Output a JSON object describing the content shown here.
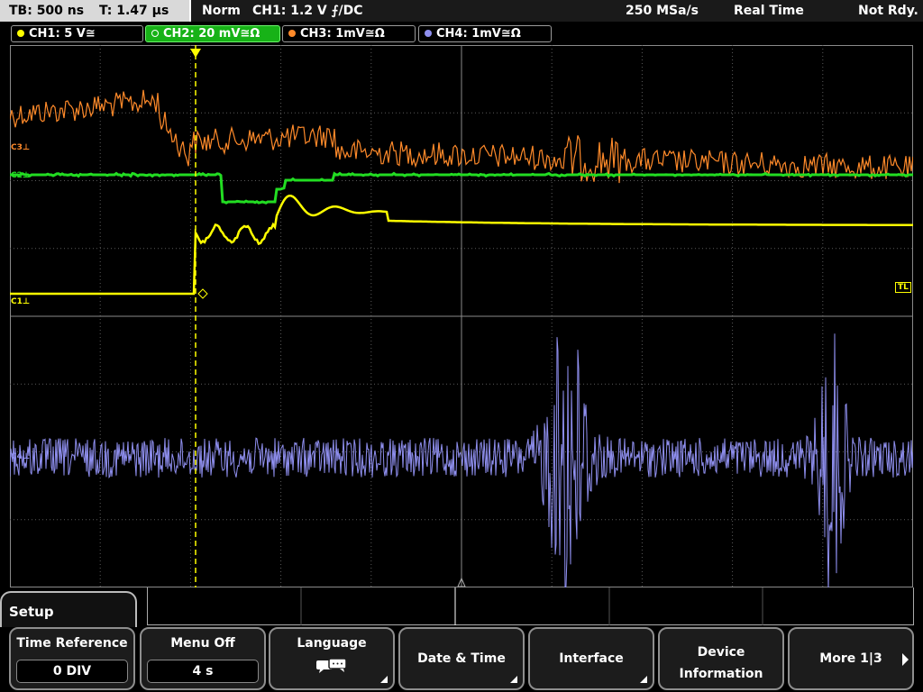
{
  "topbar": {
    "timebase": "TB: 500 ns",
    "trigger_time": "T: 1.47 µs",
    "mode": "Norm",
    "trigger_info": "CH1: 1.2 V ⨍/DC",
    "sample_rate": "250 MSa/s",
    "acq_mode": "Real Time",
    "status": "Not Rdy."
  },
  "channels": [
    {
      "label": "CH1: 5 V≅",
      "color": "#ffff00"
    },
    {
      "label": "CH2: 20 mV≅Ω",
      "color": "#22dd22"
    },
    {
      "label": "CH3: 1mV≅Ω",
      "color": "#ff8a2a"
    },
    {
      "label": "CH4: 1mV≅Ω",
      "color": "#8f8fef"
    }
  ],
  "markers": {
    "c3": "C3⊥",
    "c2": "C2⊥",
    "c1": "C1⊥",
    "c4": "C4⊥",
    "trigger_level": "TL"
  },
  "menu": {
    "tab_title": "Setup",
    "softkeys": {
      "time_reference": {
        "label": "Time Reference",
        "value": "0 DIV"
      },
      "menu_off": {
        "label": "Menu Off",
        "value": "4 s"
      },
      "language": {
        "label": "Language"
      },
      "date_time": {
        "label": "Date & Time"
      },
      "interface": {
        "label": "Interface"
      },
      "device_info": {
        "line1": "Device",
        "line2": "Information"
      },
      "more": {
        "label": "More 1|3"
      }
    }
  },
  "colors": {
    "ch1": "#ffff00",
    "ch2": "#22dd22",
    "ch3": "#ff8a2a",
    "ch4": "#8f8fef",
    "grid": "#5a5a5a",
    "trigger_marker": "#ffff00",
    "active_tab": "#17b217"
  }
}
